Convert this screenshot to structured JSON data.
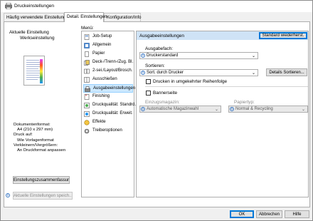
{
  "window": {
    "title": "Druckeinstellungen"
  },
  "tabs": [
    {
      "label": "Häufig verwendete Einstellungen"
    },
    {
      "label": "Detail. Einstellungen"
    },
    {
      "label": "Konfiguration/Info"
    }
  ],
  "left": {
    "current_heading": "Aktuelle Einstellung",
    "current_value": "Werkseinstellung",
    "summary_lines": [
      "Dokumentenformat:",
      "A4 (210 x 297 mm)",
      "Druck auf:",
      "Wie Vorlagenformat",
      "Verkleinern/Vergrößern:",
      "An Druckformat anpassen"
    ],
    "summary_button": "Einstellungszusammenfassung",
    "save_button": "Aktuelle Einstellungen speich..."
  },
  "menu": {
    "label": "Menü:",
    "items": [
      {
        "label": "Job-Setup",
        "icon": "job-setup-icon"
      },
      {
        "label": "Allgemein",
        "icon": "general-icon"
      },
      {
        "label": "Papier",
        "icon": "paper-icon"
      },
      {
        "label": "Deck-/Trenn-/Zug. Bl.",
        "icon": "cover-sheet-icon"
      },
      {
        "label": "2-sei./Layout/Brosch.",
        "icon": "layout-icon"
      },
      {
        "label": "Ausschießen",
        "icon": "imposition-icon"
      },
      {
        "label": "Ausgabeeinstellungen",
        "icon": "output-icon"
      },
      {
        "label": "Finishing",
        "icon": "finishing-icon"
      },
      {
        "label": "Druckqualität: Standrd.",
        "icon": "quality-standard-icon"
      },
      {
        "label": "Druckqualität: Erweit.",
        "icon": "quality-advanced-icon"
      },
      {
        "label": "Effekte",
        "icon": "effects-icon"
      },
      {
        "label": "Treiberoptionen",
        "icon": "driver-options-icon"
      }
    ],
    "selected_index": 6
  },
  "content": {
    "header": "Ausgabeeinstellungen",
    "restore_button": "Standard wiederherst.",
    "output_tray_label": "Ausgabefach:",
    "output_tray_value": "Druckerstandard",
    "sort_label": "Sortieren:",
    "sort_value": "Sort. durch Drucker",
    "sort_details_button": "Details Sortieren...",
    "reverse_order_label": "Drucken in umgekehrter Reihenfolge",
    "banner_label": "Bannerseite",
    "input_tray_label": "Einzugsmagazin:",
    "input_tray_value": "Automatische Magazinwahl",
    "paper_type_label": "Papiertyp:",
    "paper_type_value": "Normal & Recycling"
  },
  "footer": {
    "ok": "OK",
    "cancel": "Abbrechen",
    "help": "Hilfe"
  },
  "colors": {
    "accent": "#0078d7",
    "selection": "#cce8ff",
    "header_bg": "#cfe3f6",
    "info_blue": "#3b78c4"
  }
}
